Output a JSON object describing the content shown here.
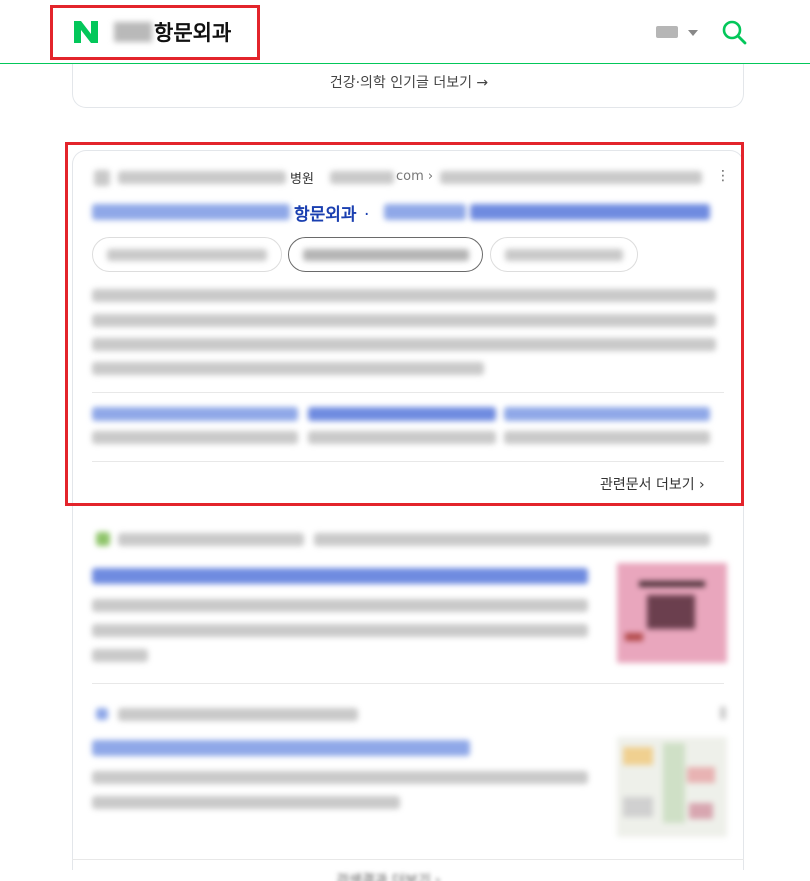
{
  "header": {
    "query_suffix": "항문외과",
    "logo_letter": "N",
    "keyboard_icon": "keyboard-icon",
    "search_icon": "search-icon",
    "accent_color": "#03c75a"
  },
  "prev_card": {
    "more_link": "건강·의학 인기글 더보기 →"
  },
  "result1": {
    "source_name": "병원",
    "source_domain": "com ›",
    "title_highlight": "항문외과",
    "title_dot": ".",
    "related_link": "관련문서 더보기 ›"
  },
  "highlight_color": "#e3242b",
  "footer": {
    "more_link": "검색결과 더보기 ›"
  }
}
